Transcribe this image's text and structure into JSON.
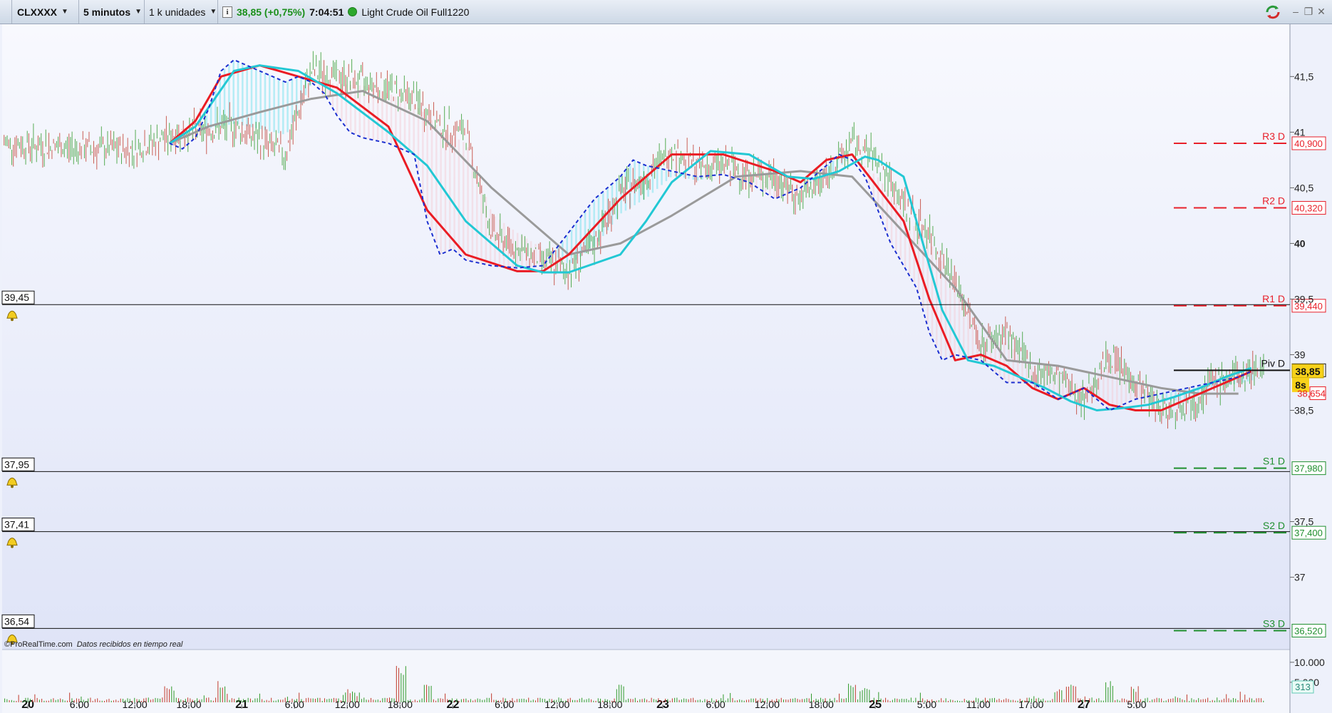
{
  "toolbar": {
    "symbol": "CLXXXX",
    "timeframe": "5 minutos",
    "units": "1 k unidades",
    "info_icon": "i",
    "last_price": "38,85 (+0,75%)",
    "clock": "7:04:51",
    "instrument": "Light Crude Oil Full1220"
  },
  "window_controls": {
    "minimize": "–",
    "restore": "❐",
    "close": "✕"
  },
  "footer": {
    "brand": "©ProRealTime.com",
    "status": "Datos recibidos en tiempo real"
  },
  "colors": {
    "price_up": "#1a8f1a",
    "resistance": "#e8202a",
    "support": "#1f8f2e",
    "ma_red": "#ea1c24",
    "ma_cyan": "#22c8d4",
    "ma_gray": "#9a9a9a",
    "ma_blue": "#1c2fd0"
  },
  "chart_data": {
    "type": "line",
    "x_ticks": [
      "20",
      "6:00",
      "12:00",
      "18:00",
      "21",
      "6:00",
      "12:00",
      "18:00",
      "22",
      "6:00",
      "12:00",
      "18:00",
      "23",
      "6:00",
      "12:00",
      "18:00",
      "25",
      "5:00",
      "11:00",
      "17:00",
      "27",
      "5:00"
    ],
    "x_bold_ticks": [
      "20",
      "21",
      "22",
      "23",
      "25",
      "27"
    ],
    "y_ticks": [
      "41,5",
      "41",
      "40,5",
      "40",
      "39,5",
      "39",
      "38,5",
      "37,5",
      "37"
    ],
    "ylim": [
      36.35,
      41.97
    ],
    "close_series": {
      "x": [
        0,
        5,
        10,
        14,
        18,
        22,
        24,
        26,
        28,
        30,
        32,
        34,
        36,
        38,
        40,
        42,
        44,
        46,
        48,
        50,
        52,
        54,
        56,
        58,
        60,
        62,
        64,
        66,
        68,
        70,
        72,
        74,
        76,
        78,
        80,
        82,
        84,
        86,
        88,
        90,
        92,
        94,
        96,
        97,
        98
      ],
      "y": [
        40.9,
        40.86,
        40.84,
        41.0,
        41.05,
        40.8,
        41.55,
        41.5,
        41.45,
        41.4,
        41.3,
        41.05,
        41.0,
        40.1,
        39.95,
        39.85,
        39.75,
        40.0,
        40.45,
        40.6,
        40.85,
        40.68,
        40.7,
        40.62,
        40.6,
        40.4,
        40.6,
        40.9,
        40.75,
        40.35,
        40.1,
        39.65,
        39.1,
        39.2,
        38.85,
        38.8,
        38.6,
        39.0,
        38.75,
        38.5,
        38.55,
        38.75,
        38.8,
        38.85,
        38.9
      ]
    },
    "series": [
      {
        "x": [
          13,
          16,
          20,
          24,
          28,
          33,
          38,
          44,
          48,
          52,
          57,
          62,
          66,
          70,
          74,
          78,
          82,
          86,
          90,
          93,
          96
        ],
        "y": [
          40.9,
          41.05,
          41.18,
          41.3,
          41.37,
          41.1,
          40.5,
          39.9,
          40.0,
          40.25,
          40.6,
          40.65,
          40.6,
          40.1,
          39.6,
          38.95,
          38.9,
          38.8,
          38.7,
          38.65,
          38.65
        ]
      },
      {
        "x": [
          13,
          15,
          17,
          20,
          23,
          26,
          30,
          33,
          36,
          40,
          42,
          44,
          48,
          52,
          56,
          60,
          62,
          64,
          66,
          68,
          70,
          72,
          74,
          76,
          78,
          80,
          82,
          84,
          86,
          88,
          90,
          92,
          94,
          96,
          97
        ],
        "y": [
          40.9,
          41.1,
          41.5,
          41.6,
          41.5,
          41.4,
          41.05,
          40.3,
          39.9,
          39.75,
          39.75,
          39.9,
          40.4,
          40.8,
          40.8,
          40.65,
          40.55,
          40.75,
          40.8,
          40.5,
          40.2,
          39.5,
          38.95,
          39.0,
          38.9,
          38.7,
          38.6,
          38.7,
          38.55,
          38.5,
          38.5,
          38.6,
          38.7,
          38.8,
          38.85
        ]
      },
      {
        "x": [
          13,
          15,
          18,
          20,
          23,
          26,
          30,
          33,
          36,
          40,
          42,
          44,
          48,
          50,
          52,
          55,
          58,
          61,
          63,
          65,
          67,
          68,
          70,
          71,
          73,
          75,
          77,
          79,
          81,
          83,
          85,
          87,
          89,
          91,
          93,
          95,
          97
        ],
        "y": [
          40.9,
          41.05,
          41.55,
          41.6,
          41.55,
          41.35,
          41.0,
          40.7,
          40.2,
          39.8,
          39.74,
          39.74,
          39.9,
          40.2,
          40.55,
          40.83,
          40.8,
          40.6,
          40.58,
          40.65,
          40.78,
          40.75,
          40.6,
          40.2,
          39.4,
          38.95,
          38.9,
          38.8,
          38.7,
          38.58,
          38.5,
          38.52,
          38.55,
          38.62,
          38.7,
          38.8,
          38.88
        ]
      },
      {
        "x": [
          13,
          14,
          15,
          16,
          17,
          18,
          20,
          22,
          23,
          24,
          25,
          26,
          27,
          28,
          30,
          32,
          33,
          34,
          35,
          36,
          38,
          40,
          42,
          44,
          46,
          48,
          49,
          50,
          52,
          54,
          56,
          58,
          60,
          62,
          64,
          65,
          66,
          67,
          68,
          69,
          70,
          71,
          72,
          73,
          74,
          76,
          78,
          80,
          82,
          84,
          86,
          88,
          90,
          92,
          94,
          96,
          97
        ],
        "y": [
          40.9,
          40.85,
          40.95,
          41.2,
          41.55,
          41.65,
          41.55,
          41.45,
          41.5,
          41.45,
          41.35,
          41.15,
          41.0,
          40.95,
          40.9,
          40.8,
          40.2,
          39.9,
          39.95,
          39.85,
          39.8,
          39.78,
          39.8,
          40.1,
          40.4,
          40.6,
          40.75,
          40.7,
          40.65,
          40.6,
          40.62,
          40.55,
          40.4,
          40.5,
          40.7,
          40.8,
          40.75,
          40.6,
          40.3,
          40.0,
          39.8,
          39.6,
          39.2,
          38.95,
          39.0,
          38.95,
          38.75,
          38.75,
          38.6,
          38.7,
          38.5,
          38.6,
          38.65,
          38.7,
          38.75,
          38.8,
          38.85
        ]
      }
    ],
    "levels": [
      {
        "label": "R3 D",
        "value": "40,900"
      },
      {
        "label": "R2 D",
        "value": "40,320"
      },
      {
        "label": "R1 D",
        "value": "39,440"
      },
      {
        "label": "Piv D",
        "value": "38,860"
      },
      {
        "label": "S1 D",
        "value": "37,980"
      },
      {
        "label": "S2 D",
        "value": "37,400"
      },
      {
        "label": "S3 D",
        "value": "36,520"
      }
    ],
    "level_numeric": [
      40.9,
      40.32,
      39.44,
      38.86,
      37.98,
      37.4,
      36.52
    ],
    "alerts": [
      {
        "label": "39,45",
        "price": 39.45
      },
      {
        "label": "37,95",
        "price": 37.95
      },
      {
        "label": "37,41",
        "price": 37.41
      },
      {
        "label": "36,54",
        "price": 36.54
      }
    ],
    "current_price": "38,85",
    "countdown": "8s",
    "red_ma_value": "38,654",
    "volume": {
      "y_ticks": [
        "10.000",
        "5.000"
      ],
      "ylim": [
        0,
        13000
      ],
      "last_value": "313",
      "spikes": [
        {
          "x": 13,
          "v": 4200
        },
        {
          "x": 17,
          "v": 5600
        },
        {
          "x": 31,
          "v": 10200
        },
        {
          "x": 33,
          "v": 4500
        },
        {
          "x": 48,
          "v": 4600
        },
        {
          "x": 66,
          "v": 5000
        },
        {
          "x": 67,
          "v": 3800
        },
        {
          "x": 82,
          "v": 4000
        },
        {
          "x": 83,
          "v": 5100
        },
        {
          "x": 86,
          "v": 5300
        },
        {
          "x": 88,
          "v": 4100
        },
        {
          "x": 27,
          "v": 3300
        }
      ]
    }
  }
}
